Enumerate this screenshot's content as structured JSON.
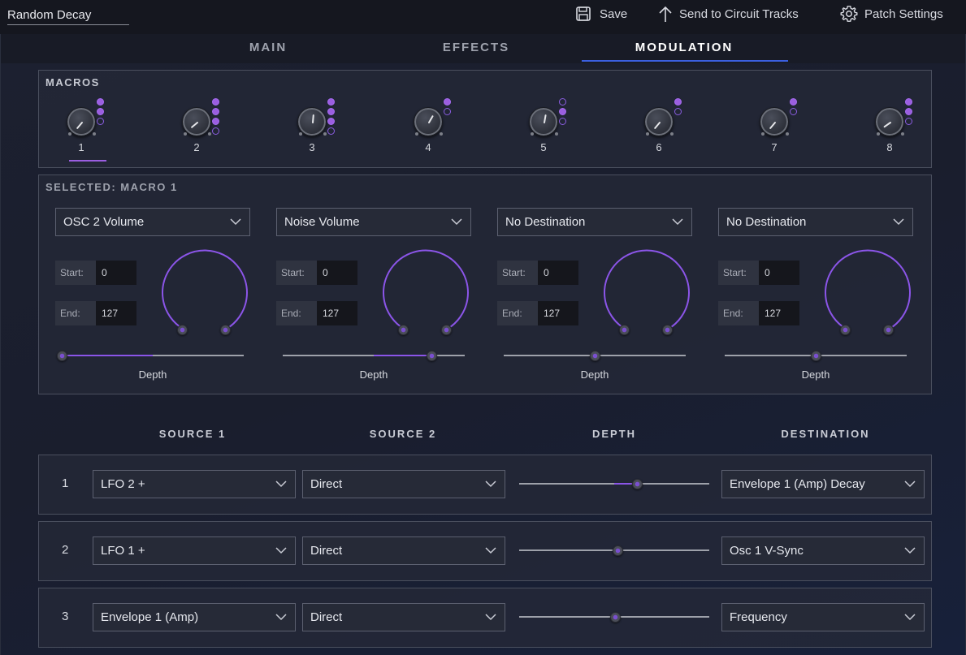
{
  "header": {
    "patch_name": "Random Decay",
    "save_label": "Save",
    "send_label": "Send to Circuit Tracks",
    "settings_label": "Patch Settings"
  },
  "tabs": [
    {
      "label": "MAIN",
      "active": false
    },
    {
      "label": "EFFECTS",
      "active": false
    },
    {
      "label": "MODULATION",
      "active": true
    }
  ],
  "macros": {
    "title": "MACROS",
    "selected": 1,
    "items": [
      {
        "label": "1",
        "dots": [
          true,
          true,
          false
        ]
      },
      {
        "label": "2",
        "dots": [
          true,
          true,
          true,
          false
        ]
      },
      {
        "label": "3",
        "dots": [
          true,
          true,
          true,
          false
        ]
      },
      {
        "label": "4",
        "dots": [
          true,
          false
        ]
      },
      {
        "label": "5",
        "dots": [
          false,
          true,
          false
        ]
      },
      {
        "label": "6",
        "dots": [
          true,
          false
        ]
      },
      {
        "label": "7",
        "dots": [
          true,
          false
        ]
      },
      {
        "label": "8",
        "dots": [
          true,
          true,
          false
        ]
      }
    ]
  },
  "selected_macro": {
    "title": "SELECTED: MACRO 1",
    "slots": [
      {
        "destination": "OSC 2 Volume",
        "start_label": "Start:",
        "start": "0",
        "end_label": "End:",
        "end": "127",
        "depth_label": "Depth",
        "depth": -1.0
      },
      {
        "destination": "Noise Volume",
        "start_label": "Start:",
        "start": "0",
        "end_label": "End:",
        "end": "127",
        "depth_label": "Depth",
        "depth": 0.63
      },
      {
        "destination": "No Destination",
        "start_label": "Start:",
        "start": "0",
        "end_label": "End:",
        "end": "127",
        "depth_label": "Depth",
        "depth": 0.0
      },
      {
        "destination": "No Destination",
        "start_label": "Start:",
        "start": "0",
        "end_label": "End:",
        "end": "127",
        "depth_label": "Depth",
        "depth": 0.0
      }
    ]
  },
  "matrix": {
    "headers": [
      "SOURCE 1",
      "SOURCE 2",
      "DEPTH",
      "DESTINATION"
    ],
    "rows": [
      {
        "num": "1",
        "source1": "LFO 2 +",
        "source2": "Direct",
        "depth": 0.24,
        "destination": "Envelope 1 (Amp) Decay"
      },
      {
        "num": "2",
        "source1": "LFO 1 +",
        "source2": "Direct",
        "depth": 0.03,
        "destination": "Osc 1 V-Sync"
      },
      {
        "num": "3",
        "source1": "Envelope 1 (Amp)",
        "source2": "Direct",
        "depth": 0.01,
        "destination": "Frequency"
      }
    ]
  },
  "colors": {
    "accent": "#9b5ee0",
    "tab_underline": "#3b5fe0"
  }
}
